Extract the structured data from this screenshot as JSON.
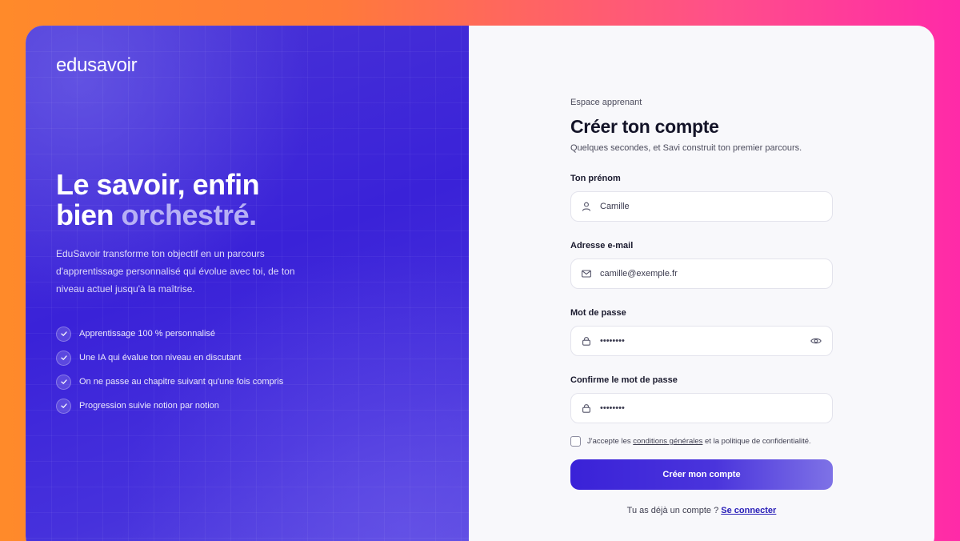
{
  "brand": {
    "logo": "edusavoir"
  },
  "hero": {
    "line1": "Le savoir, enfin",
    "line2_plain": "bien ",
    "line2_accent": "orchestré."
  },
  "lead": "EduSavoir transforme ton objectif en un parcours d'apprentissage personnalisé qui évolue avec toi, de ton niveau actuel jusqu'à la maîtrise.",
  "features": [
    "Apprentissage 100 % personnalisé",
    "Une IA qui évalue ton niveau en discutant",
    "On ne passe au chapitre suivant qu'une fois compris",
    "Progression suivie notion par notion"
  ],
  "form": {
    "eyebrow": "Espace apprenant",
    "title": "Créer ton compte",
    "subtitle": "Quelques secondes, et Savi construit ton premier parcours.",
    "firstname": {
      "label": "Ton prénom",
      "value": "Camille"
    },
    "email": {
      "label": "Adresse e-mail",
      "value": "camille@exemple.fr"
    },
    "password": {
      "label": "Mot de passe",
      "value": "••••••••"
    },
    "confirm": {
      "label": "Confirme le mot de passe",
      "value": "••••••••"
    },
    "terms": {
      "prefix": "J'accepte les ",
      "link": "conditions générales",
      "suffix": " et la politique de confidentialité.",
      "checked": false
    },
    "submit_label": "Créer mon compte",
    "signin_prompt": "Tu as déjà un compte ? ",
    "signin_link": "Se connecter"
  },
  "colors": {
    "primary": "#3a22d8",
    "accent_text": "#b7b0f5",
    "frame_left": "#ff8a2a",
    "frame_right": "#ff2aa8"
  }
}
